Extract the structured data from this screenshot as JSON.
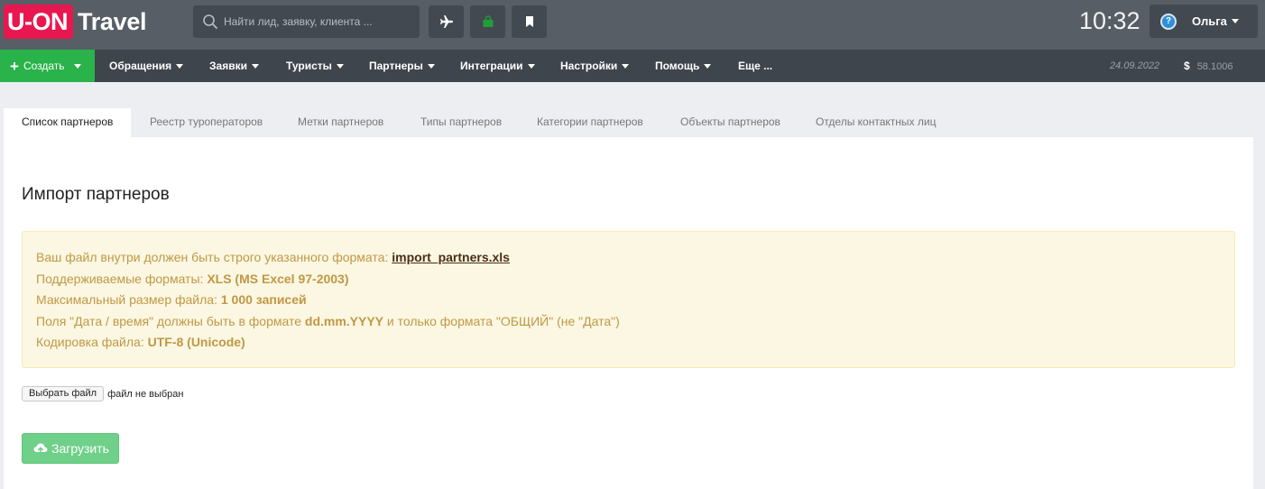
{
  "header": {
    "logo_left": "U-ON",
    "logo_right": "Travel",
    "search_placeholder": "Найти лид, заявку, клиента ...",
    "clock": "10:32",
    "user_avatar_glyph": "?",
    "user_name": "Ольга"
  },
  "nav": {
    "create_label": "Создать",
    "items": [
      "Обращения",
      "Заявки",
      "Туристы",
      "Партнеры",
      "Интеграции",
      "Настройки",
      "Помощь",
      "Еще ..."
    ],
    "date": "24.09.2022",
    "currency_symbol": "$",
    "rate": "58.1006"
  },
  "tabs": [
    "Список партнеров",
    "Реестр туроператоров",
    "Метки партнеров",
    "Типы партнеров",
    "Категории партнеров",
    "Объекты партнеров",
    "Отделы контактных лиц"
  ],
  "active_tab": 0,
  "page_title": "Импорт партнеров",
  "info": {
    "line1_text": "Ваш файл внутри должен быть строго указанного формата: ",
    "line1_link": "import_partners.xls",
    "line2_text": "Поддерживаемые форматы: ",
    "line2_bold": "XLS (MS Excel 97-2003)",
    "line3_text": "Максимальный размер файла: ",
    "line3_bold": "1 000 записей",
    "line4_text": "Поля \"Дата / время\" должны быть в формате ",
    "line4_bold": "dd.mm.YYYY",
    "line4_tail": " и только формата \"ОБЩИЙ\" (не \"Дата\")",
    "line5_text": "Кодировка файла: ",
    "line5_bold": "UTF-8 (Unicode)"
  },
  "file": {
    "choose_label": "Выбрать файл",
    "status": "файл не выбран"
  },
  "upload_label": "Загрузить",
  "colors": {
    "brand": "#e8174f",
    "create_green": "#29b34a",
    "upload_green": "#6fd08a",
    "bag_green": "#1f9e3c",
    "alert_text": "#c09846"
  }
}
